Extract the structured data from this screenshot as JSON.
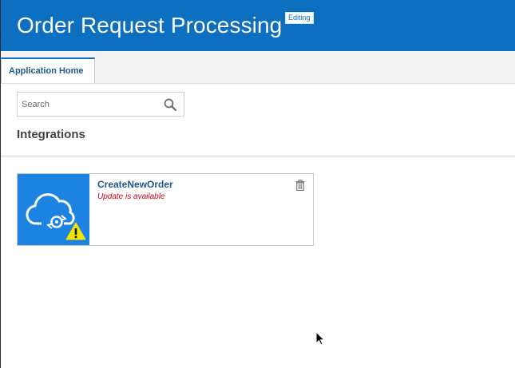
{
  "header": {
    "title": "Order Request Processing",
    "badge": "Editing"
  },
  "tabs": [
    {
      "label": "Application Home",
      "active": true
    }
  ],
  "search": {
    "placeholder": "Search",
    "value": "",
    "icon": "search-icon"
  },
  "section": {
    "title": "Integrations"
  },
  "integrations": [
    {
      "name": "CreateNewOrder",
      "status": "Update is available",
      "icon": "cloud-integration-icon",
      "warning_icon": "warning-icon",
      "delete_icon": "trash-icon"
    }
  ],
  "colors": {
    "header": "#0c6fc0",
    "thumb": "#1d83e3",
    "link": "#1d5a8e",
    "status": "#d0021b",
    "warning": "#f2e600"
  }
}
